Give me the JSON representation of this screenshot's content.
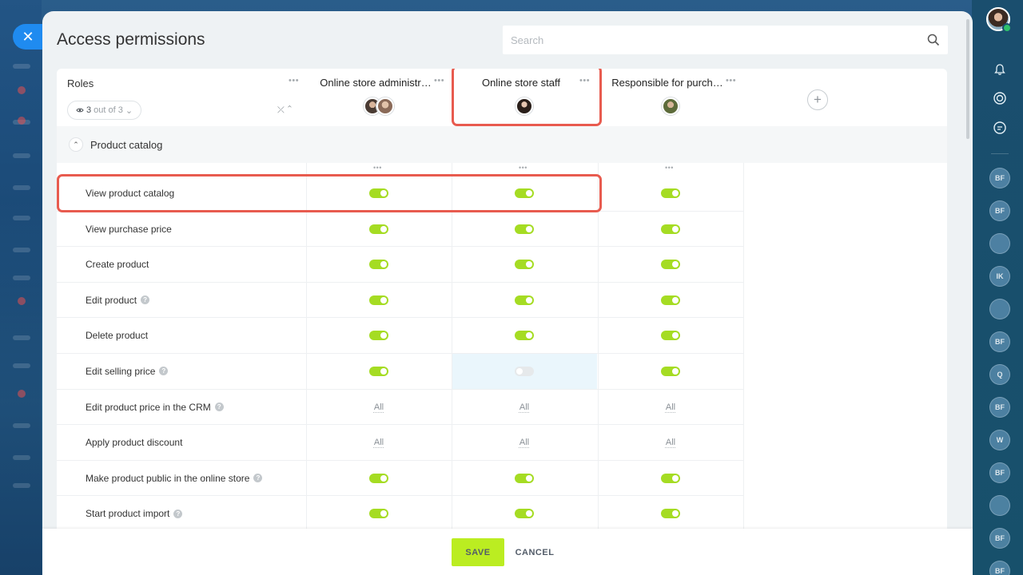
{
  "window": {
    "close_icon": "close-icon",
    "title": "Access permissions",
    "search_placeholder": "Search"
  },
  "header": {
    "roles_label": "Roles",
    "filter": {
      "count": "3",
      "suffix": "out of 3"
    },
    "roles": [
      {
        "name": "Online store administrator",
        "display": "Online store administr…"
      },
      {
        "name": "Online store staff",
        "display": "Online store staff"
      },
      {
        "name": "Responsible for purchasing",
        "display": "Responsible for purch…"
      }
    ]
  },
  "section": {
    "title": "Product catalog",
    "expanded": true
  },
  "permissions": [
    {
      "label": "View product catalog",
      "help": false,
      "values": [
        "on",
        "on",
        "on"
      ]
    },
    {
      "label": "View purchase price",
      "help": false,
      "values": [
        "on",
        "on",
        "on"
      ]
    },
    {
      "label": "Create product",
      "help": false,
      "values": [
        "on",
        "on",
        "on"
      ]
    },
    {
      "label": "Edit product",
      "help": true,
      "values": [
        "on",
        "on",
        "on"
      ]
    },
    {
      "label": "Delete product",
      "help": false,
      "values": [
        "on",
        "on",
        "on"
      ]
    },
    {
      "label": "Edit selling price",
      "help": true,
      "values": [
        "on",
        "off",
        "on"
      ]
    },
    {
      "label": "Edit product price in the CRM",
      "help": true,
      "values": [
        "All",
        "All",
        "All"
      ]
    },
    {
      "label": "Apply product discount",
      "help": false,
      "values": [
        "All",
        "All",
        "All"
      ]
    },
    {
      "label": "Make product public in the online store",
      "help": true,
      "values": [
        "on",
        "on",
        "on"
      ]
    },
    {
      "label": "Start product import",
      "help": true,
      "values": [
        "on",
        "on",
        "on"
      ]
    }
  ],
  "footer": {
    "save_label": "SAVE",
    "cancel_label": "CANCEL"
  },
  "right_rail": {
    "badges": [
      "BF",
      "BF",
      "",
      "IK",
      "",
      "BF",
      "Q",
      "BF",
      "W",
      "BF",
      "",
      "BF",
      "BF"
    ]
  },
  "colors": {
    "toggle_on": "#a5dc23",
    "highlight": "#e85b4f",
    "save_button": "#bbed21",
    "close_button": "#1f8bf0"
  }
}
